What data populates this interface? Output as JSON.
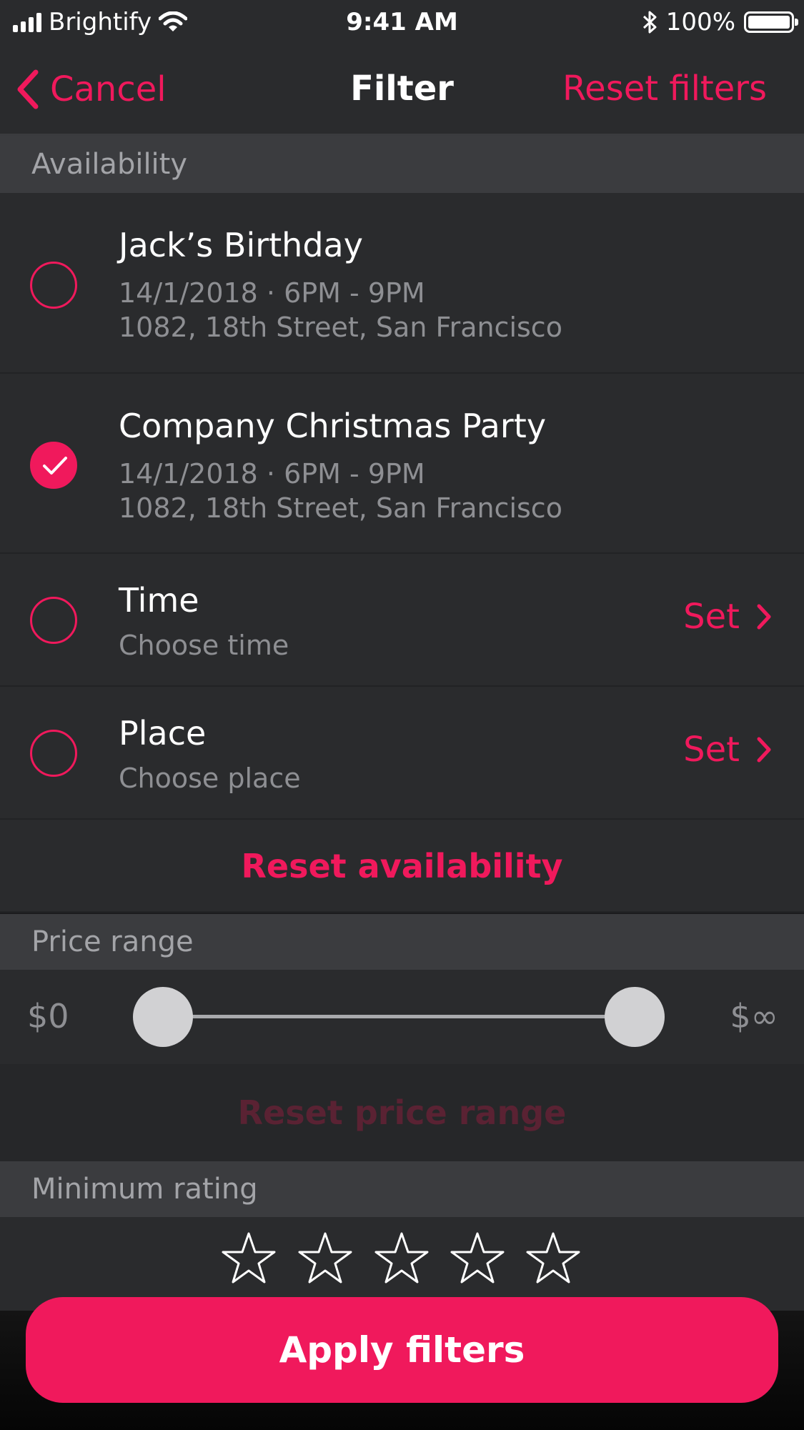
{
  "status_bar": {
    "carrier": "Brightify",
    "time": "9:41 AM",
    "battery": "100%",
    "battery_level": 1.0
  },
  "nav": {
    "cancel_label": "Cancel",
    "title": "Filter",
    "reset_label": "Reset filters"
  },
  "availability": {
    "header": "Availability",
    "events": [
      {
        "title": "Jack’s Birthday",
        "datetime": "14/1/2018 · 6PM - 9PM",
        "address": "1082, 18th Street, San Francisco",
        "selected": false
      },
      {
        "title": "Company Christmas Party",
        "datetime": "14/1/2018 · 6PM - 9PM",
        "address": "1082, 18th Street, San Francisco",
        "selected": true
      }
    ],
    "time": {
      "title": "Time",
      "subtitle": "Choose time",
      "action": "Set",
      "selected": false
    },
    "place": {
      "title": "Place",
      "subtitle": "Choose place",
      "action": "Set",
      "selected": false
    },
    "reset_label": "Reset availability"
  },
  "price_range": {
    "header": "Price range",
    "min_label": "$0",
    "max_label": "$∞",
    "lower_value_fraction": 0.0,
    "upper_value_fraction": 1.0,
    "reset_label": "Reset price range",
    "reset_enabled": false
  },
  "rating": {
    "header": "Minimum rating",
    "max_stars": 5,
    "selected_stars": 0
  },
  "apply_label": "Apply filters",
  "colors": {
    "accent": "#f0195c",
    "accent_disabled": "#5a2233",
    "background": "#2a2b2d",
    "section_header": "#3b3c3f"
  }
}
